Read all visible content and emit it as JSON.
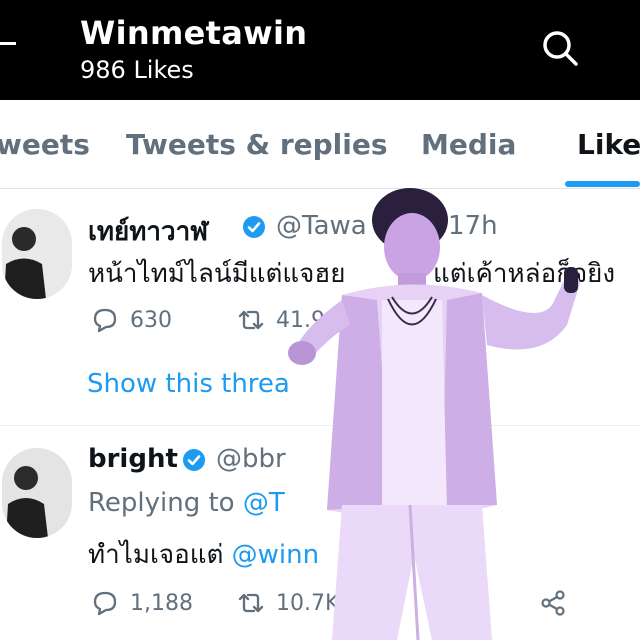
{
  "header": {
    "title": "Winmetawin",
    "subtitle": "986 Likes"
  },
  "tabs": [
    {
      "label": "weets"
    },
    {
      "label": "Tweets & replies"
    },
    {
      "label": "Media"
    },
    {
      "label": "Like"
    }
  ],
  "active_tab": "Like",
  "colors": {
    "accent": "#1d9bf0",
    "header_bg": "#000000",
    "muted": "#61707c",
    "overlay": "#b98fd9"
  },
  "icons": {
    "back": "back-arrow-icon",
    "search": "search-icon",
    "verified": "verified-badge-icon",
    "reply": "reply-icon",
    "retweet": "retweet-icon",
    "share": "share-icon"
  },
  "tweets": [
    {
      "name": "เทย์ทาวาฬ",
      "handle": "@Tawa",
      "time": "17h",
      "text": "หน้าไทม์ไลน์มีแต่แจฮย",
      "text_tail": "แต่เค้าหล่อก็จยิง",
      "replies": "630",
      "retweets": "41.9",
      "show_thread": "Show this threa"
    },
    {
      "name": "bright",
      "handle": "@bbr",
      "replying_prefix": "Replying to",
      "replying_to": "@T",
      "text": "ทำไมเจอแต่",
      "mention": "@winn",
      "replies": "1,188",
      "retweets": "10.7K"
    }
  ]
}
